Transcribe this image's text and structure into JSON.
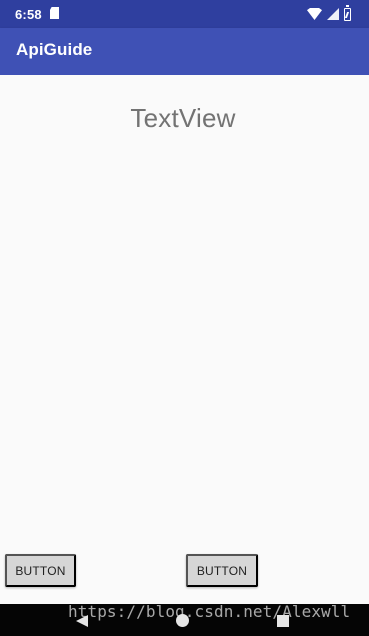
{
  "status_bar": {
    "time": "6:58",
    "icons": [
      "sd-card-icon",
      "wifi-icon",
      "signal-icon",
      "battery-icon"
    ]
  },
  "app_bar": {
    "title": "ApiGuide"
  },
  "content": {
    "text_view": "TextView",
    "buttons": [
      {
        "label": "BUTTON"
      },
      {
        "label": "BUTTON"
      }
    ]
  },
  "navigation": {
    "icons": [
      "back-icon",
      "home-icon",
      "recents-icon"
    ]
  },
  "watermark": {
    "text": "https://blog.csdn.net/Alexwll"
  },
  "colors": {
    "status_bar": "#2f3f9f",
    "app_bar": "#3f51b5",
    "content_background": "#fafafa",
    "button_background": "#d6d6d6",
    "text_view": "#737373",
    "navigation_bar": "#050505"
  }
}
